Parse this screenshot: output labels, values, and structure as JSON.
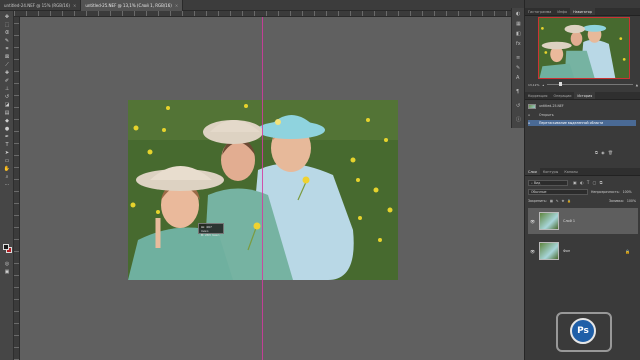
{
  "tabs": [
    {
      "label": "untitled-24.NEF @ 15% (RGB/16)",
      "active": false
    },
    {
      "label": "untitled-25.NEF @ 13,1% (Слой 1, RGB/16)",
      "active": true
    }
  ],
  "tooltip": {
    "w": "Ш: 467 пикс.",
    "h": "В: 283 пикс."
  },
  "navigator": {
    "tabs": [
      "Гистограмма",
      "Инфо",
      "Навигатор"
    ],
    "zoom": "13,12%"
  },
  "history": {
    "tabs": [
      "Коррекция",
      "Операции",
      "История"
    ],
    "items": [
      {
        "label": "untitled-25.NEF",
        "selected": false,
        "snapshot": true
      },
      {
        "label": "Открыть",
        "selected": false,
        "snapshot": false
      },
      {
        "label": "Перетаскивание выделенной области",
        "selected": true,
        "snapshot": false
      }
    ]
  },
  "layers": {
    "tabs": [
      "Слои",
      "Контуры",
      "Каналы"
    ],
    "kind_label": "Вид",
    "blend_mode": "Обычные",
    "opacity_label": "Непрозрачность:",
    "opacity_value": "100%",
    "fill_label": "Заливка:",
    "fill_value": "100%",
    "lock_label": "Закрепить:",
    "items": [
      {
        "name": "Слой 1",
        "selected": true,
        "locked": false
      },
      {
        "name": "Фон",
        "selected": false,
        "locked": true
      }
    ]
  },
  "logo": {
    "text": "Ps"
  },
  "colors": {
    "accent": "#4a6a95",
    "guide": "#d43aa0",
    "bg_swatch": "#b31e23"
  }
}
